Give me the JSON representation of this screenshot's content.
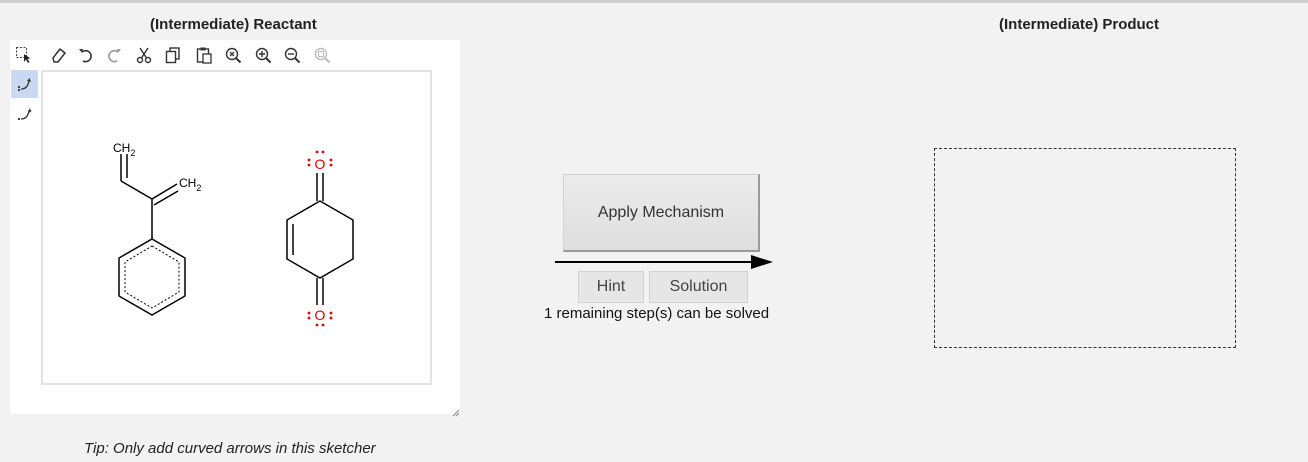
{
  "reactant": {
    "title": "(Intermediate) Reactant",
    "tip": "Tip: Only add curved arrows in this sketcher",
    "molecule_a": {
      "label_top": "CH",
      "label_top_sub": "2",
      "label_right": "CH",
      "label_right_sub": "2"
    },
    "molecule_b": {
      "atom_top": "O",
      "atom_bottom": "O"
    }
  },
  "middle": {
    "apply_label": "Apply Mechanism",
    "hint_label": "Hint",
    "solution_label": "Solution",
    "remaining_text": "1 remaining step(s) can be solved"
  },
  "product": {
    "title": "(Intermediate) Product"
  },
  "colors": {
    "oxygen": "#e00000",
    "active_tool": "#c9d9f2"
  },
  "icons": {
    "toolbar": [
      "select-icon",
      "eraser-icon",
      "undo-icon",
      "redo-icon",
      "cut-icon",
      "copy-icon",
      "paste-icon",
      "zoom-reset-icon",
      "zoom-in-icon",
      "zoom-out-icon",
      "zoom-fit-icon"
    ],
    "side": [
      "curved-arrow-pair-icon",
      "curved-arrow-single-icon"
    ]
  }
}
